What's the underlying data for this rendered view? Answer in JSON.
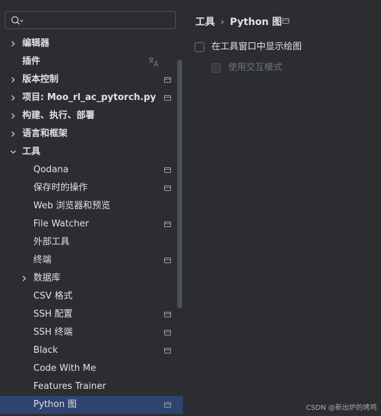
{
  "search": {
    "value": "",
    "placeholder": ""
  },
  "sidebar": {
    "items": [
      {
        "label": "编辑器",
        "level": 0,
        "chevron": "right",
        "bold": true,
        "project_icon": false
      },
      {
        "label": "插件",
        "level": 0,
        "chevron": "none",
        "bold": true,
        "project_icon": false,
        "translate_icon": true
      },
      {
        "label": "版本控制",
        "level": 0,
        "chevron": "right",
        "bold": true,
        "project_icon": true
      },
      {
        "label": "项目: Moo_rl_ac_pytorch.py",
        "level": 0,
        "chevron": "right",
        "bold": true,
        "project_icon": true
      },
      {
        "label": "构建、执行、部署",
        "level": 0,
        "chevron": "right",
        "bold": true,
        "project_icon": false
      },
      {
        "label": "语言和框架",
        "level": 0,
        "chevron": "right",
        "bold": true,
        "project_icon": false
      },
      {
        "label": "工具",
        "level": 0,
        "chevron": "down",
        "bold": true,
        "project_icon": false
      },
      {
        "label": "Qodana",
        "level": 1,
        "chevron": "none",
        "bold": false,
        "project_icon": true
      },
      {
        "label": "保存时的操作",
        "level": 1,
        "chevron": "none",
        "bold": false,
        "project_icon": true
      },
      {
        "label": "Web 浏览器和预览",
        "level": 1,
        "chevron": "none",
        "bold": false,
        "project_icon": false
      },
      {
        "label": "File Watcher",
        "level": 1,
        "chevron": "none",
        "bold": false,
        "project_icon": true
      },
      {
        "label": "外部工具",
        "level": 1,
        "chevron": "none",
        "bold": false,
        "project_icon": false
      },
      {
        "label": "终端",
        "level": 1,
        "chevron": "none",
        "bold": false,
        "project_icon": true
      },
      {
        "label": "数据库",
        "level": 1,
        "chevron": "right",
        "bold": false,
        "project_icon": false
      },
      {
        "label": "CSV 格式",
        "level": 1,
        "chevron": "none",
        "bold": false,
        "project_icon": false
      },
      {
        "label": "SSH 配置",
        "level": 1,
        "chevron": "none",
        "bold": false,
        "project_icon": true
      },
      {
        "label": "SSH 终端",
        "level": 1,
        "chevron": "none",
        "bold": false,
        "project_icon": true
      },
      {
        "label": "Black",
        "level": 1,
        "chevron": "none",
        "bold": false,
        "project_icon": true
      },
      {
        "label": "Code With Me",
        "level": 1,
        "chevron": "none",
        "bold": false,
        "project_icon": false
      },
      {
        "label": "Features Trainer",
        "level": 1,
        "chevron": "none",
        "bold": false,
        "project_icon": false
      },
      {
        "label": "Python 图",
        "level": 1,
        "chevron": "none",
        "bold": false,
        "project_icon": true,
        "selected": true
      }
    ]
  },
  "breadcrumb": {
    "parent": "工具",
    "separator": "›",
    "current": "Python 图"
  },
  "options": {
    "show_plots": {
      "label": "在工具窗口中显示绘图",
      "checked": false,
      "enabled": true
    },
    "interactive": {
      "label": "使用交互模式",
      "checked": false,
      "enabled": false
    }
  },
  "watermark": "CSDN @新出炉的烤鸡",
  "colors": {
    "background": "#2b2d30",
    "selection": "#2e436e",
    "text": "#dfe1e5",
    "muted": "#6f737a"
  },
  "icons": {
    "search": "search-icon",
    "chevron_right": "chevron-right-icon",
    "chevron_down": "chevron-down-icon",
    "project_scope": "project-scope-icon",
    "translate": "translate-icon"
  }
}
